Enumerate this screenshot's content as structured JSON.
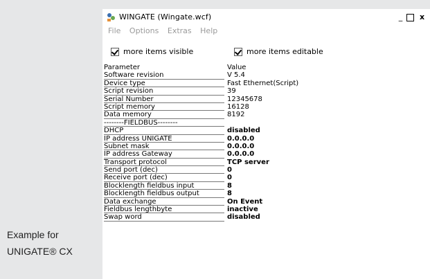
{
  "caption": {
    "line1": "Example for",
    "line2": "UNIGATE® CX"
  },
  "window": {
    "title": "WINGATE  (Wingate.wcf)",
    "minimize": "_",
    "maximize": "□",
    "close": "x"
  },
  "menu": [
    "File",
    "Options",
    "Extras",
    "Help"
  ],
  "checkboxes": {
    "visible_label": "more items visible",
    "editable_label": "more items editable"
  },
  "grid": {
    "header": {
      "param": "Parameter",
      "value": "Value"
    },
    "rows": [
      {
        "param": "Software revision",
        "value": "V 5.4",
        "bold": false
      },
      {
        "param": "Device type",
        "value": "Fast Ethernet(Script)",
        "bold": false
      },
      {
        "param": "Script revision",
        "value": "39",
        "bold": false
      },
      {
        "param": "Serial Number",
        "value": "12345678",
        "bold": false
      },
      {
        "param": "Script memory",
        "value": "16128",
        "bold": false
      },
      {
        "param": "Data memory",
        "value": "8192",
        "bold": false
      },
      {
        "param": "--------FIELDBUS--------",
        "value": "",
        "bold": false
      },
      {
        "param": "DHCP",
        "value": "disabled",
        "bold": true
      },
      {
        "param": "IP address UNIGATE",
        "value": "0.0.0.0",
        "bold": true
      },
      {
        "param": "Subnet mask",
        "value": "0.0.0.0",
        "bold": true
      },
      {
        "param": "IP address Gateway",
        "value": "0.0.0.0",
        "bold": true
      },
      {
        "param": "Transport protocol",
        "value": "TCP server",
        "bold": true
      },
      {
        "param": "Send port (dec)",
        "value": "0",
        "bold": true
      },
      {
        "param": "Receive port (dec)",
        "value": "0",
        "bold": true
      },
      {
        "param": "Blocklength fieldbus input",
        "value": "8",
        "bold": true
      },
      {
        "param": "Blocklength fieldbus output",
        "value": "8",
        "bold": true
      },
      {
        "param": "Data exchange",
        "value": "On Event",
        "bold": true
      },
      {
        "param": "Fieldbus lengthbyte",
        "value": "inactive",
        "bold": true
      },
      {
        "param": "Swap word",
        "value": "disabled",
        "bold": true
      }
    ]
  }
}
